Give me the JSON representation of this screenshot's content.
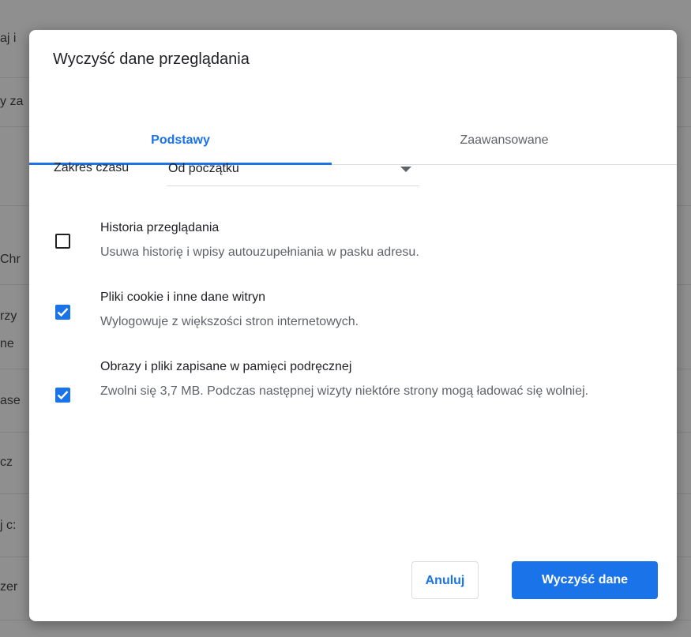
{
  "background": {
    "rows": [
      "aj i",
      "y za",
      "",
      "Chr",
      "rzy",
      "ne",
      "ase",
      "cz",
      "j c:",
      "zer"
    ]
  },
  "dialog": {
    "title": "Wyczyść dane przeglądania",
    "tabs": {
      "basic": "Podstawy",
      "advanced": "Zaawansowane",
      "active": "basic"
    },
    "time_range": {
      "label": "Zakres czasu",
      "value": "Od początku"
    },
    "options": [
      {
        "title": "Historia przeglądania",
        "description": "Usuwa historię i wpisy autouzupełniania w pasku adresu.",
        "checked": false
      },
      {
        "title": "Pliki cookie i inne dane witryn",
        "description": "Wylogowuje z większości stron internetowych.",
        "checked": true
      },
      {
        "title": "Obrazy i pliki zapisane w pamięci podręcznej",
        "description": "Zwolni się 3,7 MB. Podczas następnej wizyty niektóre strony mogą ładować się wolniej.",
        "checked": true
      }
    ],
    "buttons": {
      "cancel": "Anuluj",
      "confirm": "Wyczyść dane"
    }
  },
  "colors": {
    "accent": "#1a73e8",
    "overlay": "#8e8e8e"
  }
}
